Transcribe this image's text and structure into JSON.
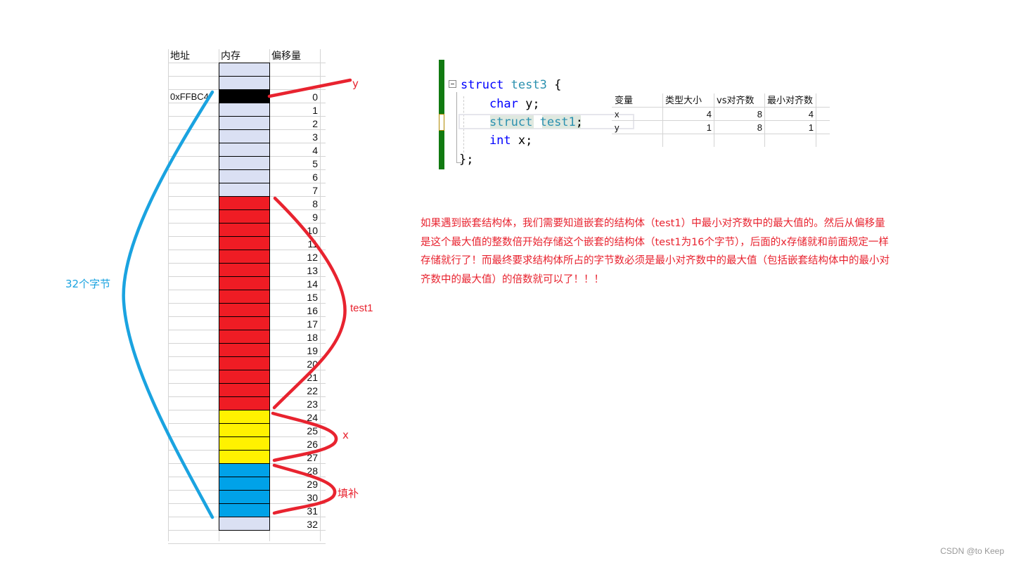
{
  "grid": {
    "headers": [
      "地址",
      "内存",
      "偏移量"
    ],
    "address_label": "0xFFBC4",
    "offsets": [
      "0",
      "1",
      "2",
      "3",
      "4",
      "5",
      "6",
      "7",
      "8",
      "9",
      "10",
      "11",
      "12",
      "13",
      "14",
      "15",
      "16",
      "17",
      "18",
      "19",
      "20",
      "21",
      "22",
      "23",
      "24",
      "25",
      "26",
      "27",
      "28",
      "29",
      "30",
      "31",
      "32"
    ],
    "leading_empty_cells": 2,
    "cell_colors": {
      "empty": "#dae0f3",
      "y": "#000000",
      "test1": "#ef1c24",
      "x": "#fff200",
      "padding": "#00a2e8"
    },
    "segments": [
      {
        "name": "pre",
        "from": -2,
        "to": -1,
        "color": "empty"
      },
      {
        "name": "y",
        "from": 0,
        "to": 0,
        "color": "y"
      },
      {
        "name": "gap",
        "from": 1,
        "to": 7,
        "color": "empty"
      },
      {
        "name": "test1",
        "from": 8,
        "to": 23,
        "color": "test1"
      },
      {
        "name": "x",
        "from": 24,
        "to": 27,
        "color": "x"
      },
      {
        "name": "padding",
        "from": 28,
        "to": 31,
        "color": "padding"
      },
      {
        "name": "after",
        "from": 32,
        "to": 32,
        "color": "empty"
      }
    ]
  },
  "annotations": {
    "y_label": "y",
    "test1_label": "test1",
    "x_label": "x",
    "padding_label": "填补",
    "total_label": "32个字节",
    "red": "#e8232f",
    "blue": "#1aa3e0"
  },
  "code": {
    "lines": [
      [
        {
          "t": "struct",
          "c": "kw"
        },
        {
          "t": " test3",
          "c": "ty"
        },
        {
          "t": " {",
          "c": "pl"
        }
      ],
      [
        {
          "t": "    char",
          "c": "kw"
        },
        {
          "t": " y;",
          "c": "pl"
        }
      ],
      [
        {
          "t": "    struct",
          "c": "ty"
        },
        {
          "t": " test1",
          "c": "ty"
        },
        {
          "t": ";",
          "c": "pl"
        }
      ],
      [
        {
          "t": "    int",
          "c": "kw"
        },
        {
          "t": " x;",
          "c": "pl"
        }
      ],
      [
        {
          "t": "};",
          "c": "pl"
        }
      ]
    ]
  },
  "var_table": {
    "headers": [
      "变量",
      "类型大小",
      "vs对齐数",
      "最小对齐数"
    ],
    "rows": [
      [
        "x",
        "4",
        "8",
        "4"
      ],
      [
        "y",
        "1",
        "8",
        "1"
      ]
    ]
  },
  "note": "如果遇到嵌套结构体，我们需要知道嵌套的结构体（test1）中最小对齐数中的最大值的。然后从偏移量是这个最大值的整数倍开始存储这个嵌套的结构体（test1为16个字节），后面的x存储就和前面规定一样存储就行了！而最终要求结构体所占的字节数必须是最小对齐数中的最大值（包括嵌套结构体中的最小对齐数中的最大值）的倍数就可以了！！！",
  "watermark": "CSDN @to Keep"
}
